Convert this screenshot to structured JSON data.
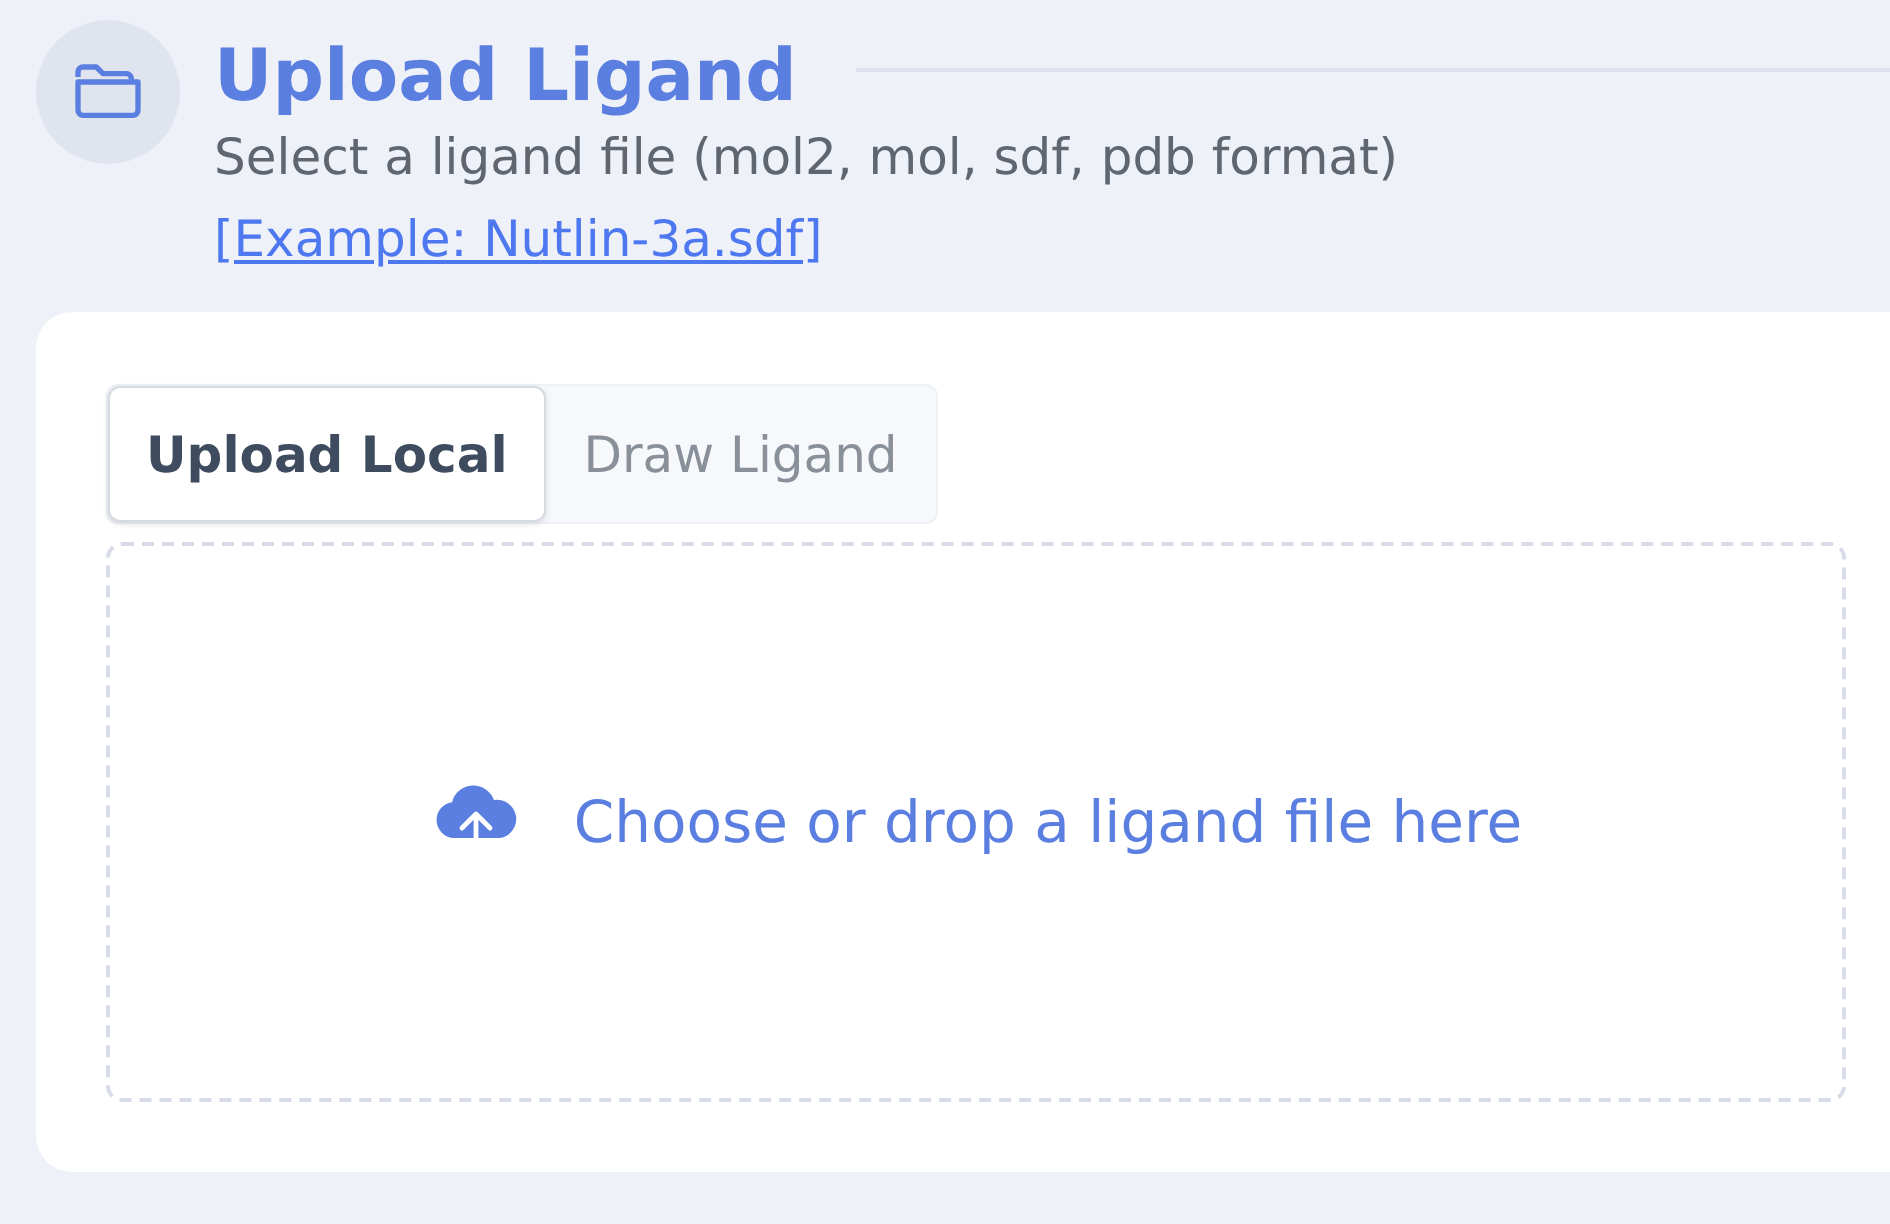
{
  "header": {
    "title": "Upload Ligand",
    "subtitle": "Select a ligand file (mol2, mol, sdf, pdb format)",
    "example_link": "[Example: Nutlin-3a.sdf]"
  },
  "tabs": [
    {
      "label": "Upload Local",
      "selected": true
    },
    {
      "label": "Draw Ligand",
      "selected": false
    }
  ],
  "dropzone": {
    "text": "Choose or drop a ligand file here"
  }
}
